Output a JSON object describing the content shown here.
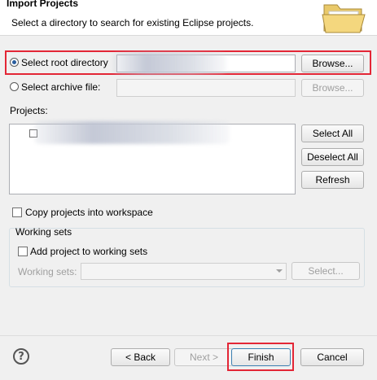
{
  "header": {
    "title": "Import Projects",
    "description": "Select a directory to search for existing Eclipse projects."
  },
  "root_directory": {
    "label": "Select root directory",
    "value": "",
    "browse_label": "Browse..."
  },
  "archive_file": {
    "label": "Select archive file:",
    "value": "",
    "browse_label": "Browse..."
  },
  "projects": {
    "label": "Projects:",
    "select_all_label": "Select All",
    "deselect_all_label": "Deselect All",
    "refresh_label": "Refresh"
  },
  "copy_projects_label": "Copy projects into workspace",
  "working_sets": {
    "group_label": "Working sets",
    "add_label": "Add project to working sets",
    "field_label": "Working sets:",
    "select_label": "Select..."
  },
  "footer": {
    "back_label": "< Back",
    "next_label": "Next >",
    "finish_label": "Finish",
    "cancel_label": "Cancel"
  },
  "colors": {
    "highlight": "#e32636",
    "radio_checked": "#2a5d9e"
  }
}
